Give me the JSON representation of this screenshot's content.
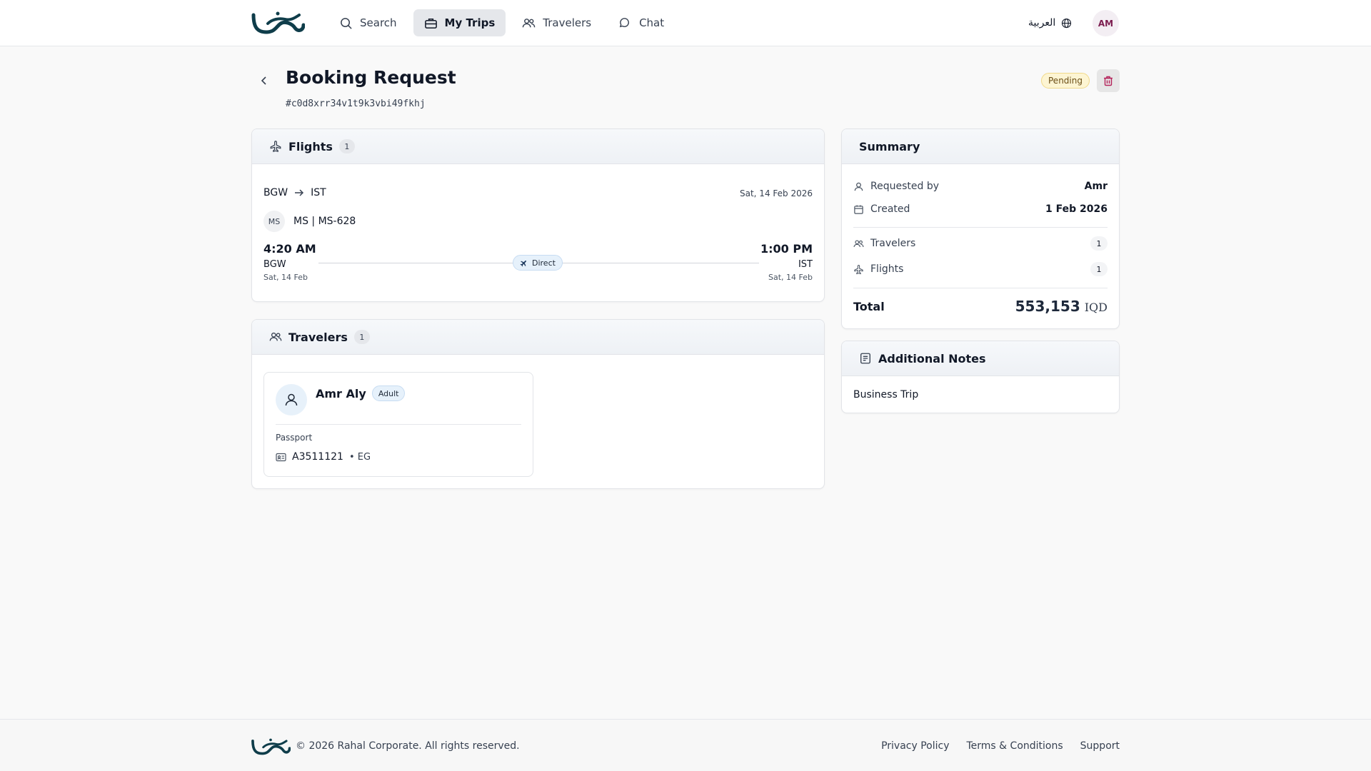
{
  "brand": {
    "logo_text": "رحال"
  },
  "nav": {
    "items": [
      {
        "label": "Search",
        "icon": "search-icon"
      },
      {
        "label": "My Trips",
        "icon": "briefcase-icon",
        "active": true
      },
      {
        "label": "Travelers",
        "icon": "users-icon"
      },
      {
        "label": "Chat",
        "icon": "chat-icon"
      }
    ],
    "language_label": "العربية",
    "avatar_initials": "AM"
  },
  "page": {
    "title": "Booking Request",
    "request_id": "#c0d8xrr34v1t9k3vbi49fkhj",
    "status": "Pending"
  },
  "flights": {
    "title": "Flights",
    "count": "1",
    "origin": "BGW",
    "destination": "IST",
    "date": "Sat, 14 Feb 2026",
    "airline_code": "MS",
    "airline_flight": "MS | MS-628",
    "departure": {
      "time": "4:20 AM",
      "code": "BGW",
      "date": "Sat, 14 Feb"
    },
    "arrival": {
      "time": "1:00 PM",
      "code": "IST",
      "date": "Sat, 14 Feb"
    },
    "stops_label": "Direct"
  },
  "travelers": {
    "title": "Travelers",
    "count": "1",
    "list": [
      {
        "name": "Amr Aly",
        "type": "Adult",
        "doc_label": "Passport",
        "doc_number": "A3511121",
        "doc_country": "• EG"
      }
    ]
  },
  "summary": {
    "title": "Summary",
    "requested_by_label": "Requested by",
    "requested_by": "Amr",
    "created_label": "Created",
    "created": "1 Feb 2026",
    "travelers_label": "Travelers",
    "travelers_count": "1",
    "flights_label": "Flights",
    "flights_count": "1",
    "total_label": "Total",
    "total_value": "553,153",
    "total_currency": "IQD"
  },
  "notes": {
    "title": "Additional Notes",
    "text": "Business Trip"
  },
  "footer": {
    "copyright": "© 2026 Rahal Corporate. All rights reserved.",
    "links": [
      "Privacy Policy",
      "Terms & Conditions",
      "Support"
    ]
  },
  "colors": {
    "accent": "#7c1d4f",
    "pending_bg": "#fdf5d3",
    "info_bg": "#e6f1fb"
  }
}
